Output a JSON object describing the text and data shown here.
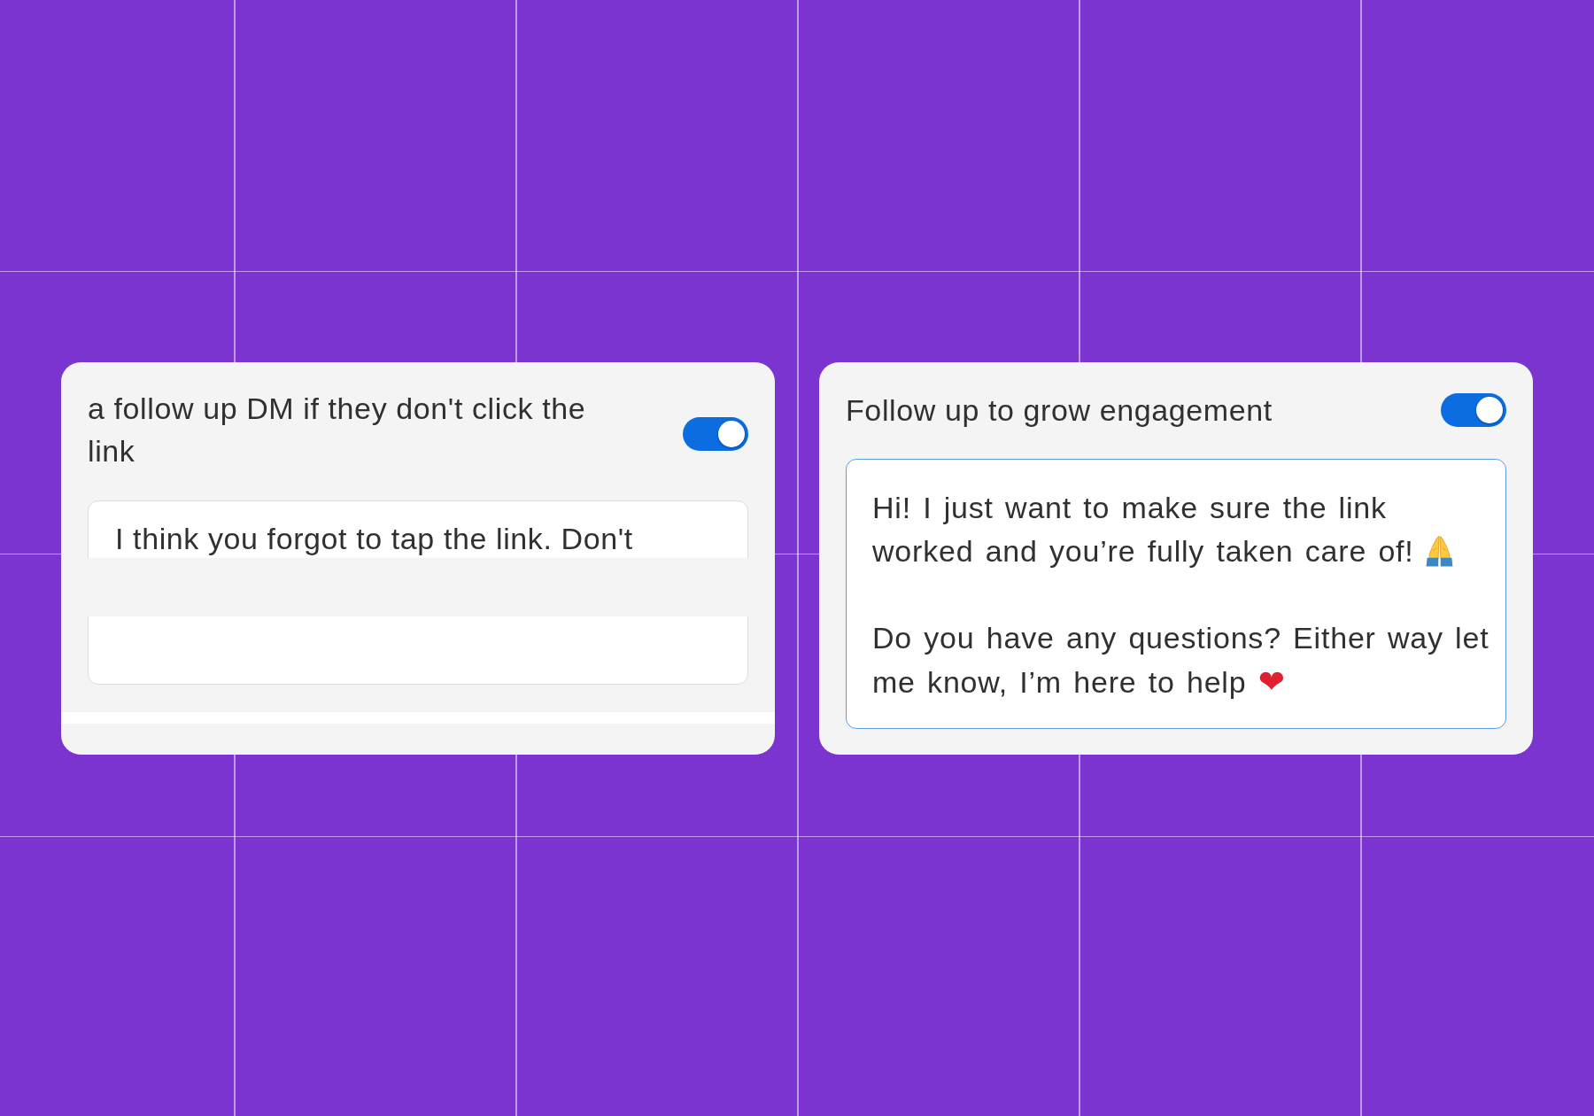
{
  "cards": [
    {
      "kind": "clipped",
      "title": "a follow up DM if they don't click the link",
      "toggle": {
        "on": true
      },
      "message": {
        "focused": false,
        "paragraphs": [
          {
            "text": "I think you forgot to tap the link. Don't"
          }
        ]
      }
    },
    {
      "kind": "open",
      "title": "Follow up to grow engagement",
      "toggle": {
        "on": true
      },
      "message": {
        "focused": true,
        "paragraphs": [
          {
            "text": "Hi! I just want to make sure the link worked and you’re fully taken care of!"
          },
          {
            "text": "Do you have any questions? Either way let me know, I’m here to help",
            "symbol": "❤"
          }
        ]
      }
    }
  ]
}
